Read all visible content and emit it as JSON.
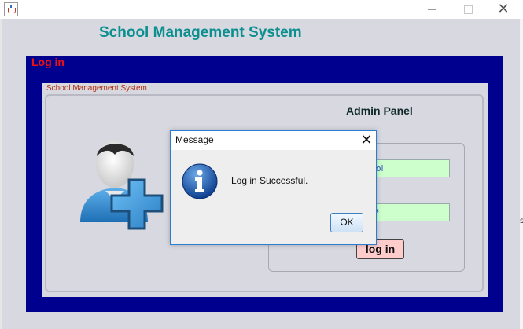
{
  "window": {
    "app_icon": "java-cup-icon",
    "controls": {
      "minimize": "minimize-icon",
      "maximize": "maximize-icon",
      "close": "close-icon",
      "close_glyph": "✕"
    }
  },
  "app": {
    "title": "School Management System",
    "section_label": "Log in",
    "panel_border_title": "School Management System",
    "panel_heading": "Admin Panel",
    "admin_icon": "admin-user-add-icon",
    "username_value": "ool",
    "password_value": "**",
    "login_button": "log in",
    "side_mark": "s"
  },
  "dialog": {
    "title": "Message",
    "close_glyph": "✕",
    "icon": "info-icon",
    "message": "Log in Successful.",
    "ok_button": "OK"
  },
  "colors": {
    "app_title": "#0c8f8f",
    "section_label": "#ee1111",
    "blue_panel": "#00008f",
    "field_bg": "#ccffcc",
    "login_button_bg": "#ffcccc",
    "dialog_border": "#2c7cd0"
  }
}
